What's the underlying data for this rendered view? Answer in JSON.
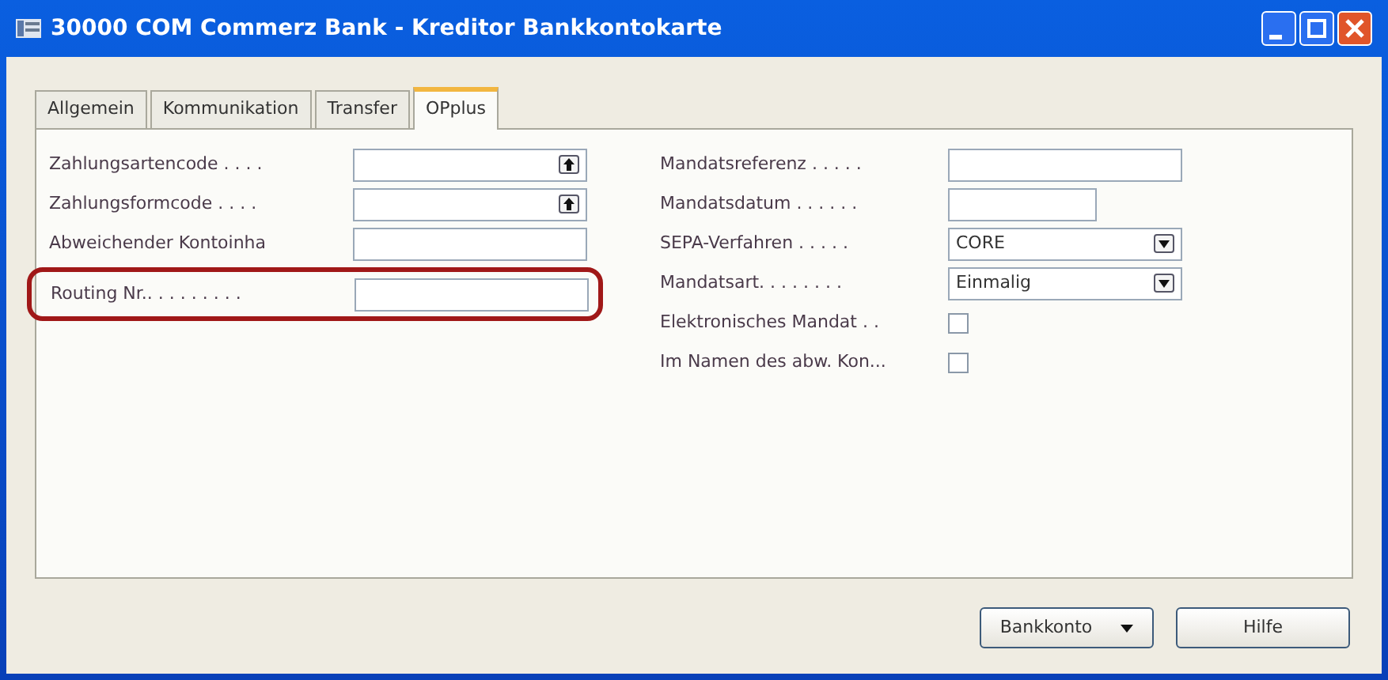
{
  "window": {
    "title": "30000 COM Commerz Bank - Kreditor Bankkontokarte"
  },
  "tabs": [
    {
      "label": "Allgemein",
      "selected": false
    },
    {
      "label": "Kommunikation",
      "selected": false
    },
    {
      "label": "Transfer",
      "selected": false
    },
    {
      "label": "OPplus",
      "selected": true
    }
  ],
  "left_fields": [
    {
      "label": "Zahlungsartencode . . . .",
      "kind": "lookup",
      "highlighted": false
    },
    {
      "label": "Zahlungsformcode . . . .",
      "kind": "lookup",
      "highlighted": false
    },
    {
      "label": "Abweichender Kontoinha",
      "kind": "text",
      "highlighted": false
    },
    {
      "label": "Routing Nr.. . . . . . . . .",
      "kind": "text",
      "highlighted": true
    }
  ],
  "right_fields": [
    {
      "label": "Mandatsreferenz . . . . .",
      "kind": "text"
    },
    {
      "label": "Mandatsdatum . . . . . .",
      "kind": "short"
    },
    {
      "label": "SEPA-Verfahren . . . . .",
      "kind": "dropdown",
      "value": "CORE"
    },
    {
      "label": "Mandatsart. . . . . . . .",
      "kind": "dropdown",
      "value": "Einmalig"
    },
    {
      "label": "Elektronisches Mandat . .",
      "kind": "checkbox",
      "checked": false
    },
    {
      "label": "Im Namen des abw. Kon...",
      "kind": "checkbox",
      "checked": false
    }
  ],
  "buttons": [
    {
      "label": "Bankkonto",
      "kind": "menu"
    },
    {
      "label": "Hilfe",
      "kind": "plain"
    }
  ]
}
